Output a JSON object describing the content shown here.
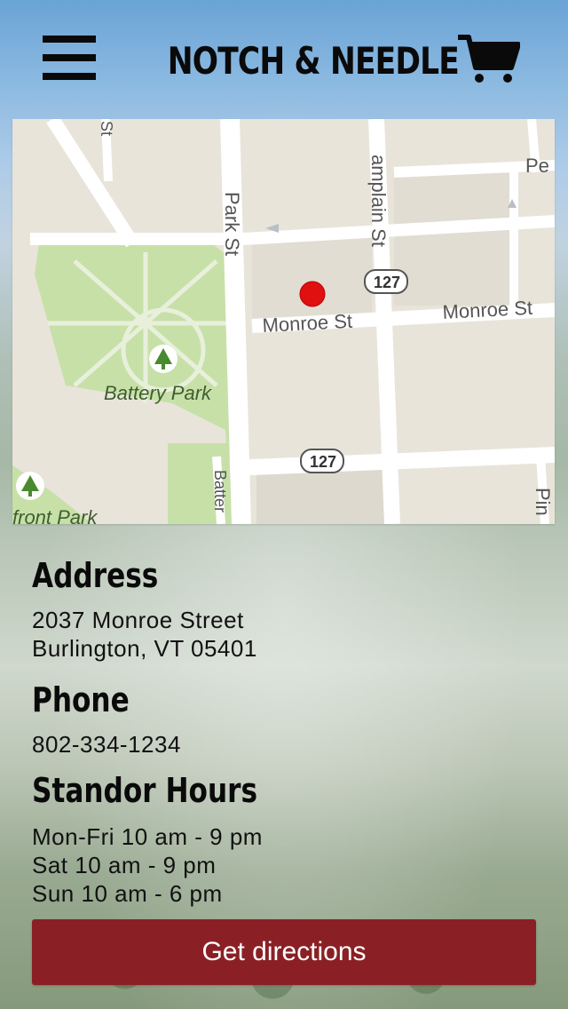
{
  "header": {
    "brand": "NOTCH & NEEDLE",
    "menu_icon": "hamburger-menu-icon",
    "cart_icon": "shopping-cart-icon"
  },
  "map": {
    "labels": {
      "park_st": "Park St",
      "champlain_st": "amplain St",
      "monroe_st_1": "Monroe St",
      "monroe_st_2": "Monroe St",
      "battery_park": "Battery Park",
      "front_park": "front Park",
      "route_127_a": "127",
      "route_127_b": "127",
      "pe": "Pe",
      "pin": "Pin",
      "battery_st": "Batter",
      "st_top": "St"
    },
    "marker_color": "#e01010"
  },
  "address": {
    "heading": "Address",
    "line1": "2037 Monroe Street",
    "line2": "Burlington, VT 05401"
  },
  "phone": {
    "heading": "Phone",
    "number": "802-334-1234"
  },
  "hours": {
    "heading": "Standor Hours",
    "lines": [
      "Mon-Fri 10 am - 9 pm",
      "Sat 10 am - 9 pm",
      "Sun 10 am - 6 pm"
    ]
  },
  "actions": {
    "directions_label": "Get directions"
  },
  "colors": {
    "accent": "#8a2025",
    "text": "#111111",
    "park_green": "#c7e0a8"
  }
}
